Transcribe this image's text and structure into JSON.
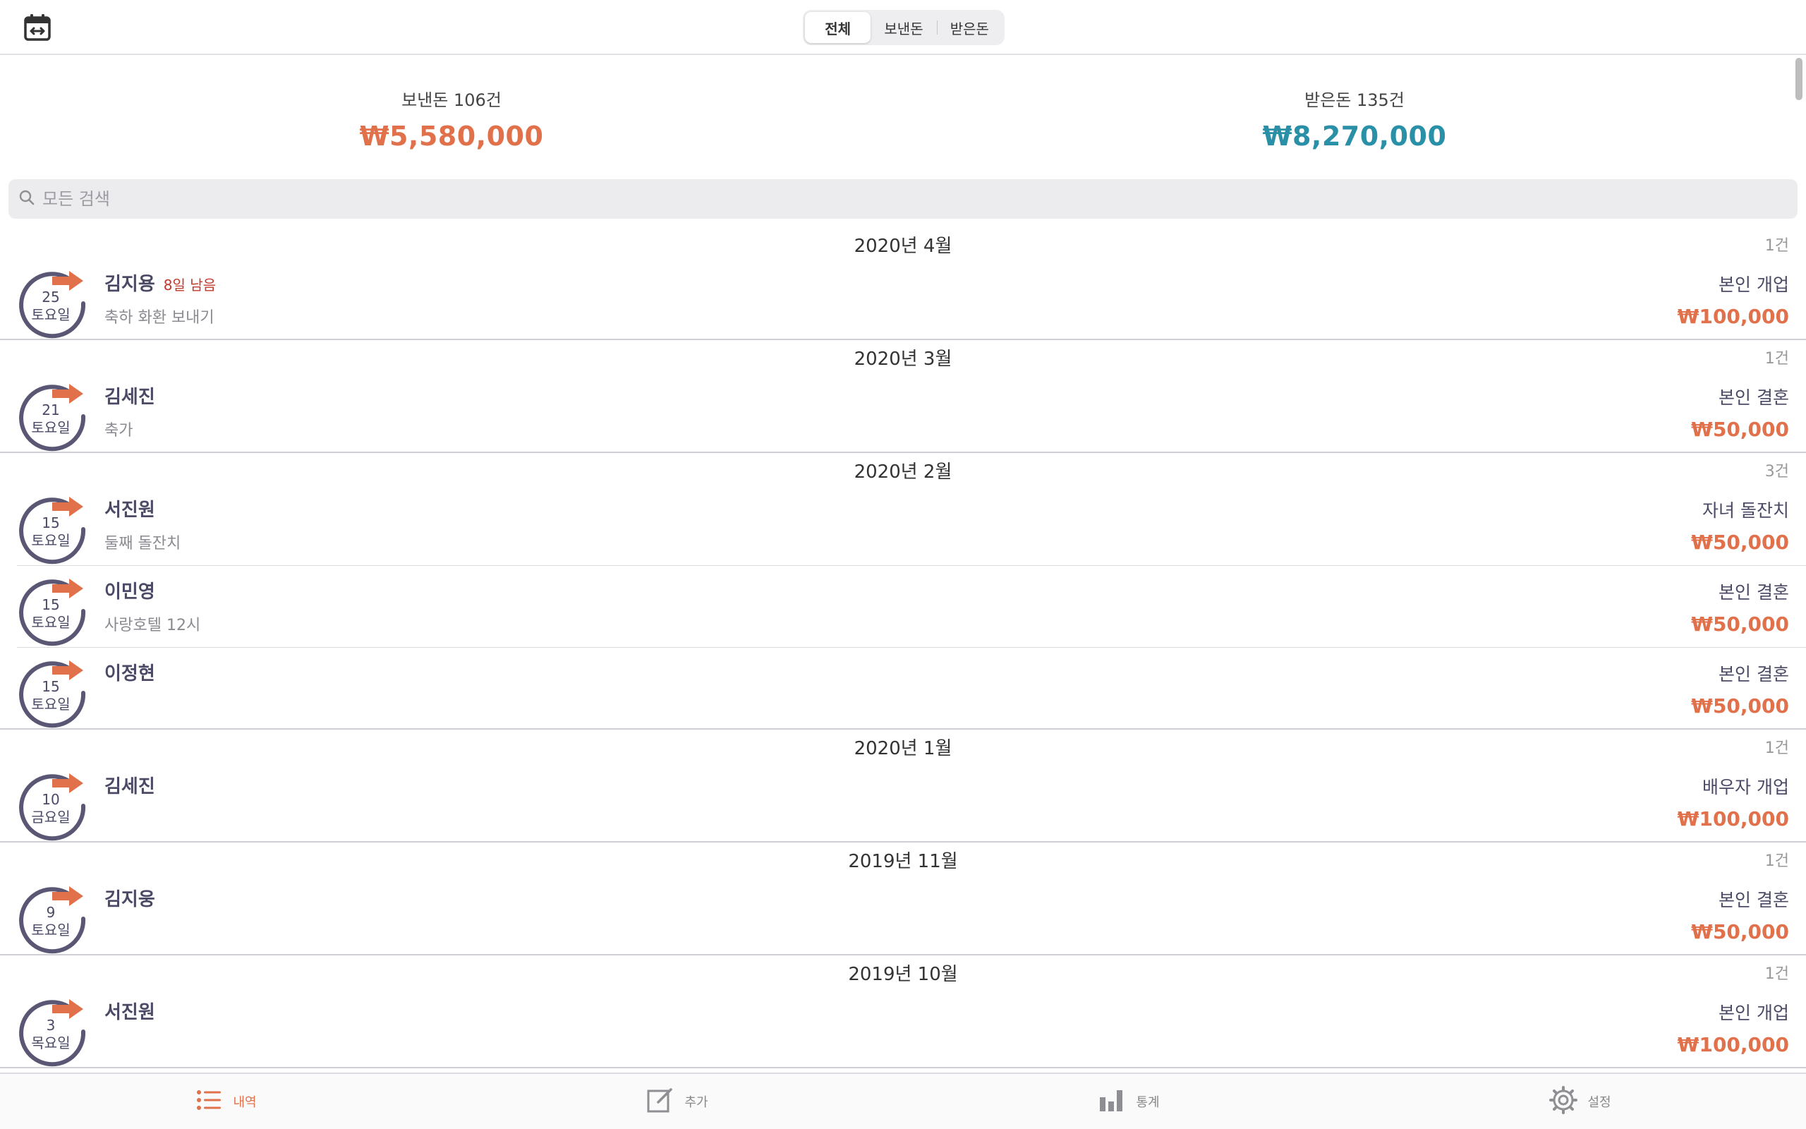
{
  "segment": {
    "all": "전체",
    "sent": "보낸돈",
    "received": "받은돈"
  },
  "summary": {
    "sent_label": "보낸돈 106건",
    "sent_amount": "₩5,580,000",
    "received_label": "받은돈 135건",
    "received_amount": "₩8,270,000"
  },
  "search": {
    "placeholder": "모든 검색"
  },
  "sections": [
    {
      "title": "2020년 4월",
      "count": "1건",
      "rows": [
        {
          "day": "25",
          "weekday": "토요일",
          "name": "김지용",
          "dday": "8일 남음",
          "memo": "축하 화환 보내기",
          "event": "본인 개업",
          "amount": "₩100,000"
        }
      ]
    },
    {
      "title": "2020년 3월",
      "count": "1건",
      "rows": [
        {
          "day": "21",
          "weekday": "토요일",
          "name": "김세진",
          "memo": "축가",
          "event": "본인 결혼",
          "amount": "₩50,000"
        }
      ]
    },
    {
      "title": "2020년 2월",
      "count": "3건",
      "rows": [
        {
          "day": "15",
          "weekday": "토요일",
          "name": "서진원",
          "memo": "둘째 돌잔치",
          "event": "자녀 돌잔치",
          "amount": "₩50,000"
        },
        {
          "day": "15",
          "weekday": "토요일",
          "name": "이민영",
          "memo": "사랑호텔 12시",
          "event": "본인 결혼",
          "amount": "₩50,000"
        },
        {
          "day": "15",
          "weekday": "토요일",
          "name": "이정현",
          "memo": "",
          "event": "본인 결혼",
          "amount": "₩50,000"
        }
      ]
    },
    {
      "title": "2020년 1월",
      "count": "1건",
      "rows": [
        {
          "day": "10",
          "weekday": "금요일",
          "name": "김세진",
          "memo": "",
          "event": "배우자 개업",
          "amount": "₩100,000"
        }
      ]
    },
    {
      "title": "2019년 11월",
      "count": "1건",
      "rows": [
        {
          "day": "9",
          "weekday": "토요일",
          "name": "김지웅",
          "memo": "",
          "event": "본인 결혼",
          "amount": "₩50,000"
        }
      ]
    },
    {
      "title": "2019년 10월",
      "count": "1건",
      "rows": [
        {
          "day": "3",
          "weekday": "목요일",
          "name": "서진원",
          "memo": "",
          "event": "본인 개업",
          "amount": "₩100,000"
        }
      ]
    }
  ],
  "tabs": {
    "history": "내역",
    "add": "추가",
    "stats": "통계",
    "settings": "설정"
  },
  "colors": {
    "sent": "#e0714a",
    "received": "#2a90a8",
    "badge": "#5a5775",
    "arrow": "#e0714a"
  }
}
